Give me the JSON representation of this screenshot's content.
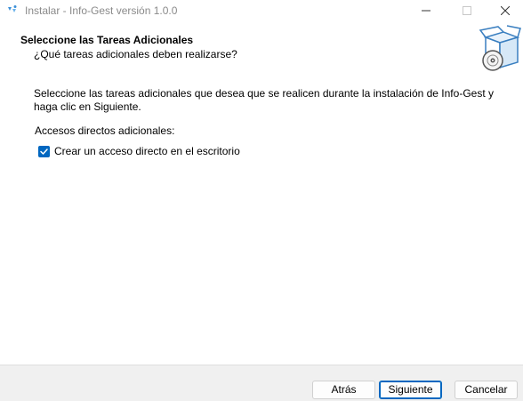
{
  "window": {
    "title": "Instalar - Info-Gest versión 1.0.0"
  },
  "header": {
    "title": "Seleccione las Tareas Adicionales",
    "subtitle": "¿Qué tareas adicionales deben realizarse?"
  },
  "content": {
    "description": "Seleccione las tareas adicionales que desea que se realicen durante la instalación de Info-Gest y haga clic en Siguiente.",
    "group_label": "Accesos directos adicionales:",
    "tasks": [
      {
        "label": "Crear un acceso directo en el escritorio",
        "checked": true
      }
    ]
  },
  "buttons": {
    "back": "Atrás",
    "next": "Siguiente",
    "cancel": "Cancelar"
  },
  "colors": {
    "accent": "#0067c0",
    "footer_bg": "#f0f0f0",
    "title_text": "#8a8a8a"
  },
  "icons": {
    "app": "installer-icon",
    "header": "package-box-disc-icon",
    "check": "checkmark-icon",
    "minimize": "minimize-icon",
    "maximize": "maximize-icon",
    "close": "close-icon"
  }
}
